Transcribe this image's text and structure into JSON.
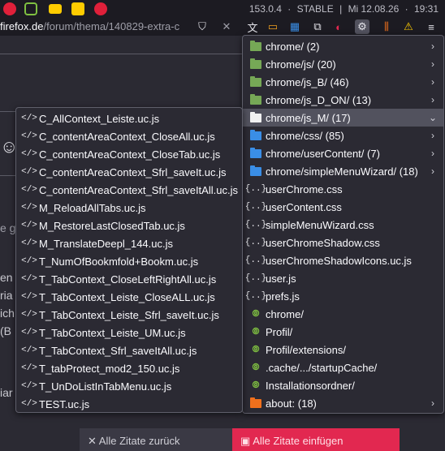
{
  "status_bar": {
    "version": "153.0.4",
    "channel": "STABLE",
    "date": "Mi  12.08.26",
    "time": "19:31"
  },
  "url": {
    "host": "firefox.de",
    "path": "/forum/thema/140829-extra-c"
  },
  "page": {
    "frag1": "en",
    "frag2": "ria",
    "frag3": "ich",
    "frag4": "(B",
    "frag5": "iar",
    "frag6": "e g",
    "btn_left": "Alle Zitate zurück",
    "btn_right": "Alle Zitate einfügen"
  },
  "menu_right": [
    {
      "label": "chrome/ (2)",
      "icon": "folder-green",
      "submenu": true
    },
    {
      "label": "chrome/js/ (20)",
      "icon": "folder-green",
      "submenu": true
    },
    {
      "label": "chrome/js_B/ (46)",
      "icon": "folder-green",
      "submenu": true
    },
    {
      "label": "chrome/js_D_ON/ (13)",
      "icon": "folder-green",
      "submenu": true
    },
    {
      "label": "chrome/js_M/ (17)",
      "icon": "folder-white",
      "submenu": true,
      "open": true
    },
    {
      "label": "chrome/css/ (85)",
      "icon": "folder-blue",
      "submenu": true
    },
    {
      "label": "chrome/userContent/ (7)",
      "icon": "folder-blue",
      "submenu": true
    },
    {
      "label": "chrome/simpleMenuWizard/ (18)",
      "icon": "folder-blue",
      "submenu": true
    },
    {
      "label": "userChrome.css",
      "icon": "css-file"
    },
    {
      "label": "userContent.css",
      "icon": "css-file"
    },
    {
      "label": "simpleMenuWizard.css",
      "icon": "css-file"
    },
    {
      "label": "userChromeShadow.css",
      "icon": "css-file"
    },
    {
      "label": "userChromeShadowIcons.uc.js",
      "icon": "css-file"
    },
    {
      "label": "user.js",
      "icon": "css-file"
    },
    {
      "label": "prefs.js",
      "icon": "css-file"
    },
    {
      "label": "chrome/",
      "icon": "green-folder-link"
    },
    {
      "label": "Profil/",
      "icon": "green-folder-link"
    },
    {
      "label": "Profil/extensions/",
      "icon": "green-folder-link"
    },
    {
      "label": ".cache/.../startupCache/",
      "icon": "green-folder-link"
    },
    {
      "label": "Installationsordner/",
      "icon": "green-folder-link"
    },
    {
      "label": "about: (18)",
      "icon": "folder-orange",
      "submenu": true
    }
  ],
  "menu_left": [
    "C_AllContext_Leiste.uc.js",
    "C_contentAreaContext_CloseAll.uc.js",
    "C_contentAreaContext_CloseTab.uc.js",
    "C_contentAreaContext_Sfrl_saveIt.uc.js",
    "C_contentAreaContext_Sfrl_saveItAll.uc.js",
    "M_ReloadAllTabs.uc.js",
    "M_RestoreLastClosedTab.uc.js",
    "M_TranslateDeepl_144.uc.js",
    "T_NumOfBookmfold+Bookm.uc.js",
    "T_TabContext_CloseLeftRightAll.uc.js",
    "T_TabContext_Leiste_CloseALL.uc.js",
    "T_TabContext_Leiste_Sfrl_saveIt.uc.js",
    "T_TabContext_Leiste_UM.uc.js",
    "T_TabContext_Sfrl_saveItAll.uc.js",
    "T_tabProtect_mod2_150.uc.js",
    "T_UnDoListInTabMenu.uc.js",
    "TEST.uc.js"
  ],
  "colors": {
    "accent": "#52525e",
    "folder_green": "#76a856",
    "folder_blue": "#3a8ee6",
    "folder_orange": "#f0701c",
    "btn_danger": "#e22850"
  }
}
